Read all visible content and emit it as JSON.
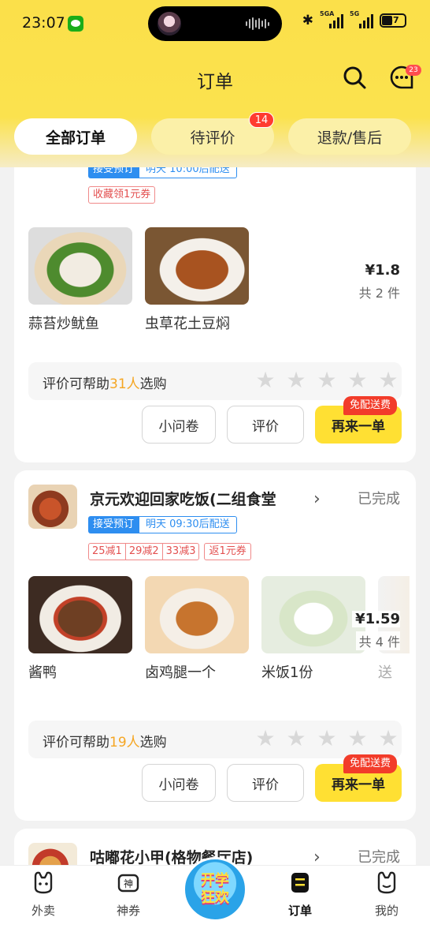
{
  "status": {
    "time": "23:07",
    "net1": "5GA",
    "net2": "5G",
    "battery": "57"
  },
  "header": {
    "title": "订单",
    "message_badge": "23"
  },
  "tabs": [
    {
      "label": "全部订单",
      "active": true
    },
    {
      "label": "待评价",
      "badge": "14"
    },
    {
      "label": "退款/售后"
    }
  ],
  "orders": [
    {
      "tags": {
        "preorder": "接受预订",
        "delivery": "明天 10:00后配送",
        "coupons": [
          "收藏领1元券"
        ]
      },
      "items": [
        {
          "name": "蒜苔炒鱿鱼"
        },
        {
          "name": "虫草花土豆焖"
        }
      ],
      "price": "¥1.8",
      "count": "共 2 件",
      "rate": {
        "prefix": "评价可帮助",
        "num": "31人",
        "suffix": "选购"
      },
      "buttons": {
        "survey": "小问卷",
        "review": "评价",
        "reorder": "再来一单",
        "badge": "免配送费"
      }
    },
    {
      "shop": "京元欢迎回家吃饭(二组食堂",
      "state": "已完成",
      "tags": {
        "preorder": "接受预订",
        "delivery": "明天 09:30后配送",
        "discounts": [
          "25减1",
          "29减2",
          "33减3"
        ],
        "coupons": [
          "返1元券"
        ]
      },
      "items": [
        {
          "name": "酱鸭"
        },
        {
          "name": "卤鸡腿一个"
        },
        {
          "name": "米饭1份"
        },
        {
          "name": "送"
        }
      ],
      "price": "¥1.59",
      "count": "共 4 件",
      "rate": {
        "prefix": "评价可帮助",
        "num": "19人",
        "suffix": "选购"
      },
      "buttons": {
        "survey": "小问卷",
        "review": "评价",
        "reorder": "再来一单",
        "badge": "免配送费"
      }
    },
    {
      "shop": "咕嘟花小甲(格物餐厅店)",
      "state": "已完成"
    }
  ],
  "nav": [
    {
      "label": "外卖"
    },
    {
      "label": "神券"
    },
    {
      "label": "开学狂欢",
      "line1": "开学",
      "line2": "狂欢"
    },
    {
      "label": "订单",
      "active": true
    },
    {
      "label": "我的"
    }
  ]
}
